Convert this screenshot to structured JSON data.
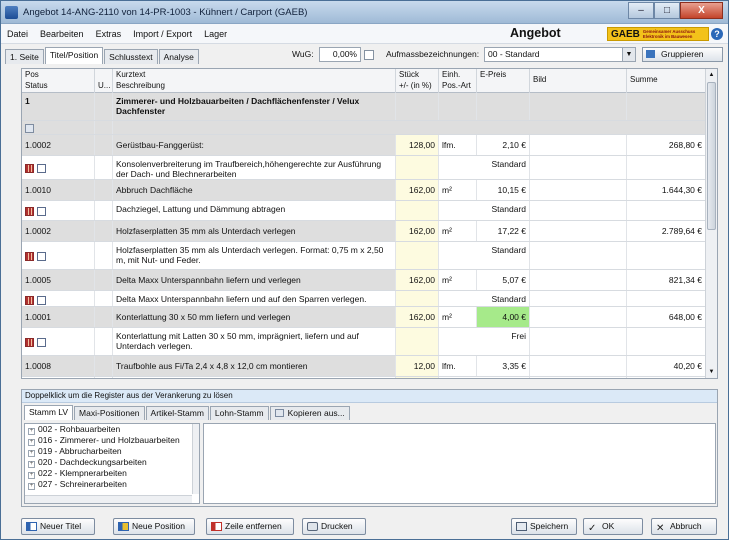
{
  "window": {
    "title": "Angebot 14-ANG-2110 von 14-PR-1003 - Kühnert / Carport  (GAEB)",
    "minimize": "–",
    "maximize": "□",
    "close": "X"
  },
  "menu": {
    "datei": "Datei",
    "bearbeiten": "Bearbeiten",
    "extras": "Extras",
    "import_export": "Import / Export",
    "lager": "Lager",
    "doc_title": "Angebot",
    "gaeb_logo": "GAEB",
    "gaeb_sub": "Gemeinsamer Ausschuss Elektronik im Bauwesen",
    "help": "?"
  },
  "tabs": [
    "1. Seite",
    "Titel/Position",
    "Schlusstext",
    "Analyse"
  ],
  "toolbar": {
    "wug_label": "WuG:",
    "wug_value": "0,00%",
    "aufm_label": "Aufmassbezeichnungen:",
    "aufm_value": "00 - Standard",
    "gruppieren": "Gruppieren"
  },
  "columns": {
    "pos": "Pos",
    "status": "Status",
    "u": "U...",
    "kurztext": "Kurztext",
    "beschreibung": "Beschreibung",
    "stueck": "Stück",
    "plusminus": "+/- (in %)",
    "einh": "Einh.",
    "posart": "Pos.-Art",
    "epreis": "E-Preis",
    "bild": "Bild",
    "summe": "Summe"
  },
  "title_row": {
    "pos": "1",
    "text": "Zimmerer- und Holzbauarbeiten / Dachflächenfenster / Velux Dachfenster"
  },
  "positions": [
    {
      "pos": "1.0002",
      "kurztext": "Gerüstbau-Fanggerüst:",
      "stueck": "128,00",
      "einh": "lfm.",
      "epreis": "2,10 €",
      "summe": "268,80 €",
      "beschreibung": "Konsolenverbreiterung im Traufbereich,höhengerechte zur  Ausführung der Dach- und Blechnerarbeiten",
      "posart": "Standard"
    },
    {
      "pos": "1.0010",
      "kurztext": "Abbruch Dachfläche",
      "stueck": "162,00",
      "einh": "m²",
      "epreis": "10,15 €",
      "summe": "1.644,30 €",
      "beschreibung": "Dachziegel, Lattung und Dämmung abtragen",
      "posart": "Standard"
    },
    {
      "pos": "1.0002",
      "kurztext": "Holzfaserplatten 35 mm als Unterdach verlegen",
      "stueck": "162,00",
      "einh": "m²",
      "epreis": "17,22 €",
      "summe": "2.789,64 €",
      "beschreibung": "Holzfaserplatten 35 mm als Unterdach verlegen. Format: 0,75 m x 2,50 m, mit Nut- und Feder.",
      "posart": "Standard"
    },
    {
      "pos": "1.0005",
      "kurztext": "Delta Maxx Unterspannbahn liefern und verlegen",
      "stueck": "162,00",
      "einh": "m²",
      "epreis": "5,07 €",
      "summe": "821,34 €",
      "beschreibung": "Delta Maxx Unterspannbahn liefern und auf den Sparren verlegen.",
      "posart": "Standard"
    },
    {
      "pos": "1.0001",
      "kurztext": "Konterlattung 30 x 50 mm liefern und verlegen",
      "stueck": "162,00",
      "einh": "m²",
      "epreis": "4,00 €",
      "summe": "648,00 €",
      "beschreibung": "Konterlattung mit Latten 30 x 50 mm, imprägniert, liefern und auf Unterdach verlegen.",
      "posart": "Frei"
    },
    {
      "pos": "1.0008",
      "kurztext": "Traufbohle aus Fi/Ta 2,4 x 4,8 x 12,0 cm montieren",
      "stueck": "12,00",
      "einh": "lfm.",
      "epreis": "3,35 €",
      "summe": "40,20 €",
      "beschreibung": "Traufbohle aus Fi/Ta 2,4 x 4,8 x 12,0 cm liefern und montieren.",
      "posart": "Standard"
    }
  ],
  "lower": {
    "hint": "Doppelklick um die Register aus der Verankerung zu lösen",
    "tabs": [
      "Stamm LV",
      "Maxi-Positionen",
      "Artikel-Stamm",
      "Lohn-Stamm",
      "Kopieren aus..."
    ],
    "tree": [
      "002 - Rohbauarbeiten",
      "016 - Zimmerer- und Holzbauarbeiten",
      "019 - Abbrucharbeiten",
      "020 - Dachdeckungsarbeiten",
      "022 - Klempnerarbeiten",
      "027 - Schreinerarbeiten"
    ]
  },
  "buttons": {
    "neuer_titel": "Neuer Titel",
    "neue_position": "Neue Position",
    "zeile_entfernen": "Zeile entfernen",
    "drucken": "Drucken",
    "speichern": "Speichern",
    "ok": "OK",
    "abbrechen": "Abbruch"
  }
}
